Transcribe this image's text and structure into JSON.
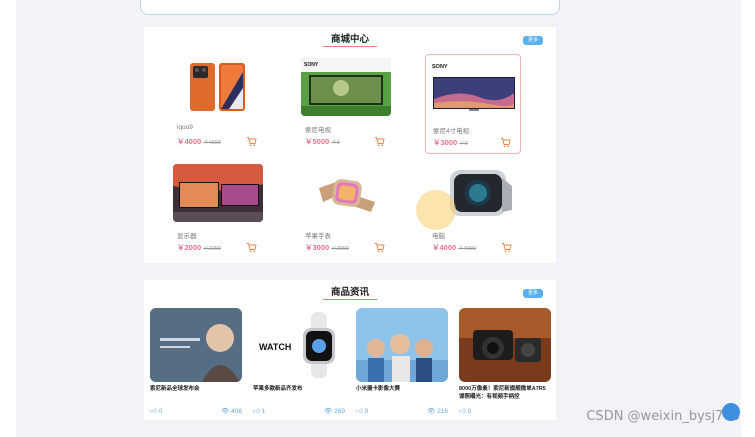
{
  "mall": {
    "title": "商城中心",
    "more_label": "更多",
    "products": [
      {
        "name": "iqoo9",
        "price": "￥4000",
        "old_price": "￥4600"
      },
      {
        "name": "索尼电视",
        "price": "￥5000",
        "old_price": "￥0"
      },
      {
        "name": "索尼4寸电视",
        "price": "￥3000",
        "old_price": "￥0"
      },
      {
        "name": "显示器",
        "price": "￥2000",
        "old_price": "￥2000"
      },
      {
        "name": "苹果手表",
        "price": "￥3000",
        "old_price": "￥3000"
      },
      {
        "name": "电脑",
        "price": "￥4000",
        "old_price": "￥4000"
      }
    ]
  },
  "news": {
    "title": "商品资讯",
    "more_label": "更多",
    "items": [
      {
        "title": "索尼新品全球发布会",
        "likes": "0",
        "views": "406"
      },
      {
        "title": "苹果多款新品齐发布",
        "likes": "1",
        "views": "269"
      },
      {
        "title": "小米摄卡影像大赛",
        "likes": "0",
        "views": "216"
      },
      {
        "title": "8000万像素！索尼新旗舰微单A7R5谍照曝光：有视频手柄控",
        "likes": "0",
        "views": ""
      }
    ]
  },
  "image_text": {
    "tv_brand": "SONY",
    "tv_brand_2": "SONY",
    "watch_logo": "WATCH"
  },
  "watermark": "CSDN @weixin_bysj703",
  "colors": {
    "accent": "#5ab0f0",
    "price": "#e8738c",
    "title_underline": "#ec7a7a"
  }
}
